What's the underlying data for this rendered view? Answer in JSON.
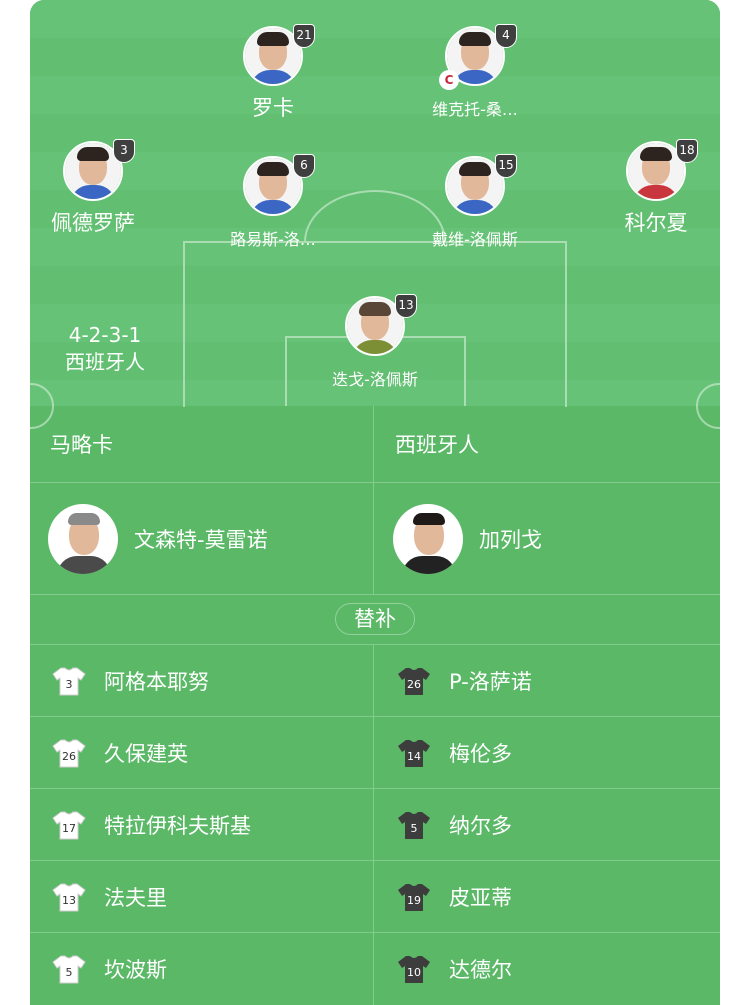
{
  "formation": {
    "shape": "4-2-3-1",
    "team": "西班牙人"
  },
  "pitch_players": [
    {
      "id": "p1",
      "name": "罗卡",
      "number": "21",
      "captain": false
    },
    {
      "id": "p2",
      "name": "维克托-桑…",
      "number": "4",
      "captain": true,
      "captain_label": "C"
    },
    {
      "id": "p3",
      "name": "佩德罗萨",
      "number": "3",
      "captain": false
    },
    {
      "id": "p4",
      "name": "路易斯-洛…",
      "number": "6",
      "captain": false
    },
    {
      "id": "p5",
      "name": "戴维-洛佩斯",
      "number": "15",
      "captain": false
    },
    {
      "id": "p6",
      "name": "科尔夏",
      "number": "18",
      "captain": false
    },
    {
      "id": "p7",
      "name": "迭戈-洛佩斯",
      "number": "13",
      "captain": false
    }
  ],
  "teams": {
    "left": "马略卡",
    "right": "西班牙人"
  },
  "coaches": {
    "left": "文森特-莫雷诺",
    "right": "加列戈"
  },
  "subs_label": "替补",
  "colors": {
    "home_shirt": "#ffffff",
    "away_shirt": "#3d3d3d",
    "pitch": "#66c276",
    "badge": "#3f3f3f",
    "captain": "#c8283c"
  },
  "substitutes": [
    {
      "left": {
        "number": "3",
        "name": "阿格本耶努"
      },
      "right": {
        "number": "26",
        "name": "P-洛萨诺"
      }
    },
    {
      "left": {
        "number": "26",
        "name": "久保建英"
      },
      "right": {
        "number": "14",
        "name": "梅伦多"
      }
    },
    {
      "left": {
        "number": "17",
        "name": "特拉伊科夫斯基"
      },
      "right": {
        "number": "5",
        "name": "纳尔多"
      }
    },
    {
      "left": {
        "number": "13",
        "name": "法夫里"
      },
      "right": {
        "number": "19",
        "name": "皮亚蒂"
      }
    },
    {
      "left": {
        "number": "5",
        "name": "坎波斯"
      },
      "right": {
        "number": "10",
        "name": "达德尔"
      }
    }
  ]
}
